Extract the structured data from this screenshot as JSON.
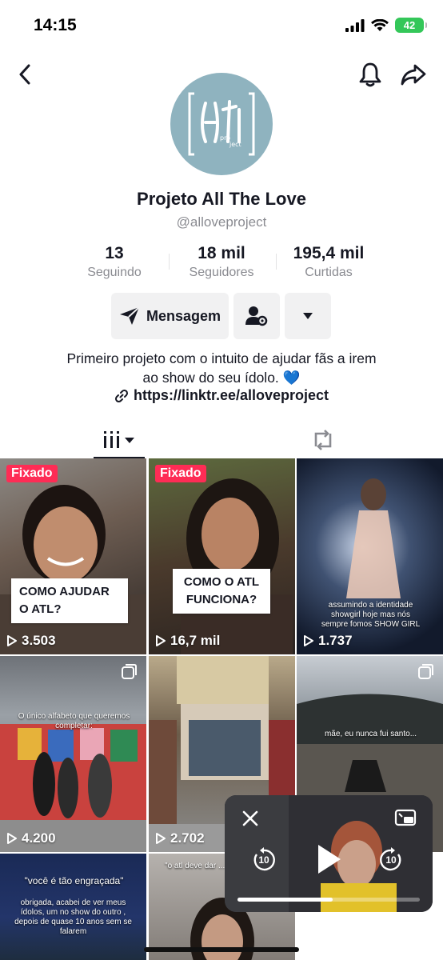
{
  "status": {
    "time": "14:15",
    "battery": "42"
  },
  "profile": {
    "display_name": "Projeto All The Love",
    "handle": "@alloveproject",
    "avatar_text": "ATL project"
  },
  "stats": [
    {
      "value": "13",
      "label": "Seguindo"
    },
    {
      "value": "18 mil",
      "label": "Seguidores"
    },
    {
      "value": "195,4 mil",
      "label": "Curtidas"
    }
  ],
  "actions": {
    "message_label": "Mensagem"
  },
  "bio": {
    "line1": "Primeiro projeto com o intuito de ajudar fãs a irem",
    "line2": "ao show do seu ídolo. 💙",
    "link": "https://linktr.ee/alloveproject"
  },
  "videos": [
    {
      "pinned_label": "Fixado",
      "views": "3.503",
      "caption": "COMO AJUDAR O ATL?"
    },
    {
      "pinned_label": "Fixado",
      "views": "16,7 mil",
      "caption": "COMO O ATL FUNCIONA?"
    },
    {
      "views": "1.737",
      "overlay": "assumindo a identidade showgirl hoje mas nós sempre fomos SHOW GIRL"
    },
    {
      "views": "4.200",
      "overlay": "O único alfabeto que queremos completar:"
    },
    {
      "views": "2.702",
      "overlay": ""
    },
    {
      "views": "",
      "overlay": "mãe, eu nunca fui santo..."
    },
    {
      "views": "",
      "overlay": "\"você é tão engraçada\"",
      "overlay2": "obrigada, acabei de ver meus ídolos, um no show do outro , depois de quase 10 anos sem se falarem"
    },
    {
      "views": "",
      "overlay": "\"o atl deve dar ... com ... ?\""
    }
  ],
  "pip": {
    "skip_back": "10",
    "skip_forward": "10",
    "progress": 0.52
  },
  "colors": {
    "pin_badge": "#fe2c55",
    "battery": "#34c759",
    "avatar_bg": "#8fb3bf"
  }
}
